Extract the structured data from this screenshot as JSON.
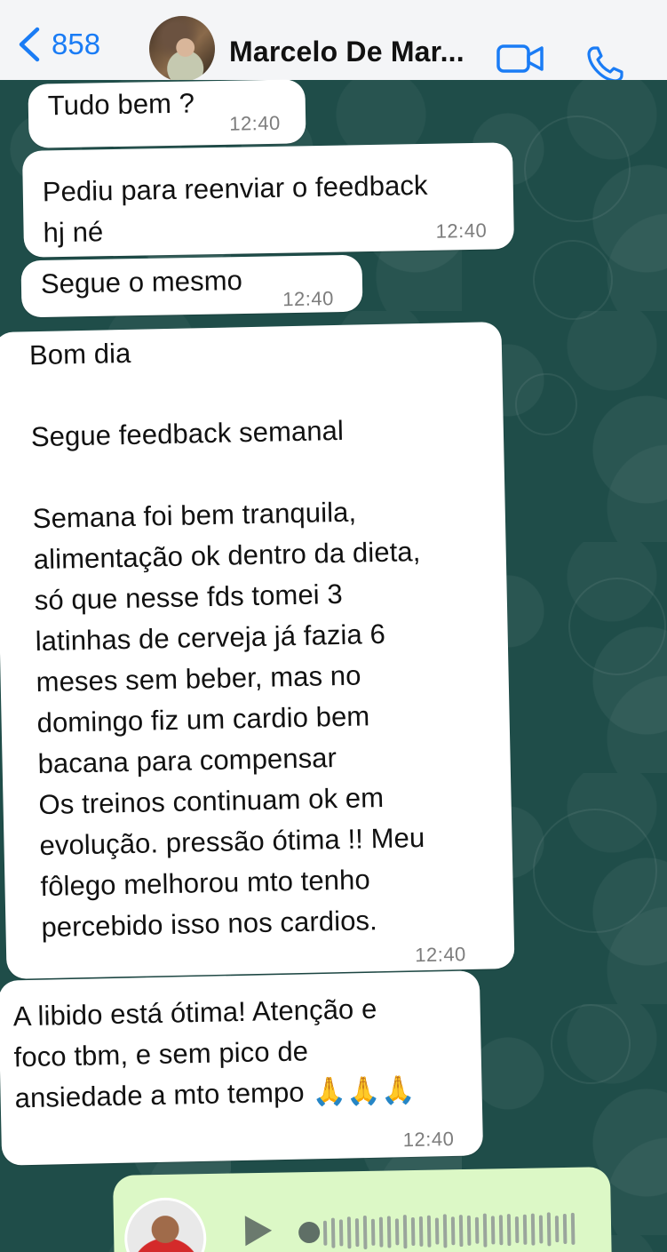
{
  "header": {
    "back_label": "858",
    "contact_name": "Marcelo De Mar..."
  },
  "messages": [
    {
      "text": "Tudo bem ?",
      "time": "12:40"
    },
    {
      "text": "Pediu para reenviar o feedback\nhj né",
      "time": "12:40"
    },
    {
      "text": "Segue o mesmo",
      "time": "12:40"
    },
    {
      "text": "Bom dia\n\nSegue feedback semanal\n\nSemana foi bem tranquila,\nalimentação ok dentro da dieta,\nsó que nesse fds tomei 3\nlatinhas de cerveja já fazia 6\nmeses sem beber, mas no\ndomingo fiz um cardio bem\nbacana para compensar\nOs treinos continuam ok em\nevolução. pressão ótima !! Meu\nfôlego melhorou mto tenho\npercebido isso nos cardios.",
      "time": "12:40"
    },
    {
      "text": "A libido está ótima! Atenção e\nfoco tbm, e sem pico de\nansiedade a mto tempo 🙏🙏🙏",
      "time": "12:40"
    }
  ],
  "colors": {
    "accent": "#1a7cf5",
    "chat_background": "#1f4d49",
    "bubble_incoming": "#ffffff",
    "bubble_outgoing": "#dcf8c6"
  },
  "icons": {
    "back": "chevron-left-icon",
    "video": "video-camera-icon",
    "call": "phone-icon",
    "play": "play-icon"
  }
}
